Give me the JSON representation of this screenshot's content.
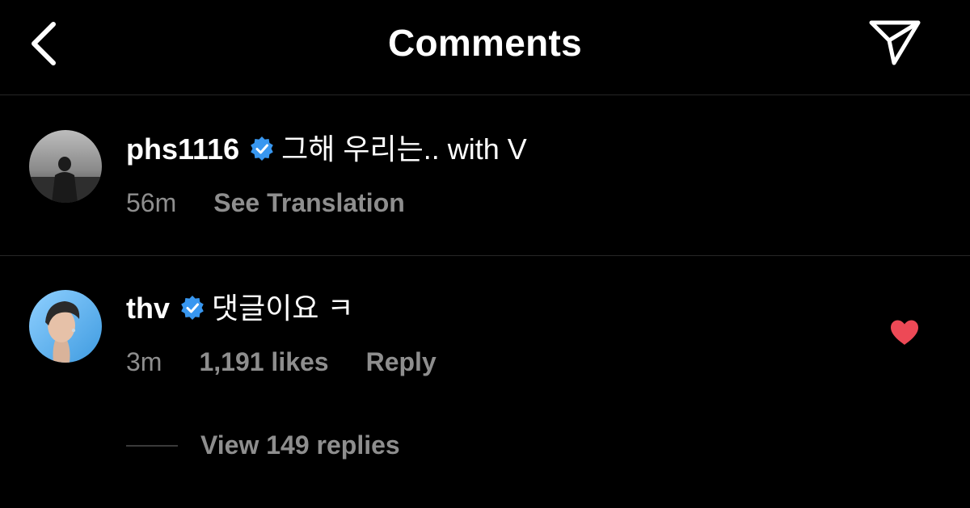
{
  "header": {
    "title": "Comments",
    "back_icon": "chevron-left-icon",
    "share_icon": "paper-plane-icon"
  },
  "comments": [
    {
      "username": "phs1116",
      "verified": true,
      "text": "그해 우리는.. with V",
      "time": "56m",
      "actions": [
        "See Translation"
      ]
    },
    {
      "username": "thv",
      "verified": true,
      "text": "댓글이요 ㅋ",
      "time": "3m",
      "likes": "1,191 likes",
      "actions": [
        "Reply"
      ],
      "liked": true,
      "view_replies": "View 149 replies"
    }
  ],
  "colors": {
    "background": "#000000",
    "text": "#ffffff",
    "secondary_text": "#8e8e8e",
    "verified_blue": "#3897f0",
    "heart_red": "#ed4956",
    "divider": "#262626"
  }
}
